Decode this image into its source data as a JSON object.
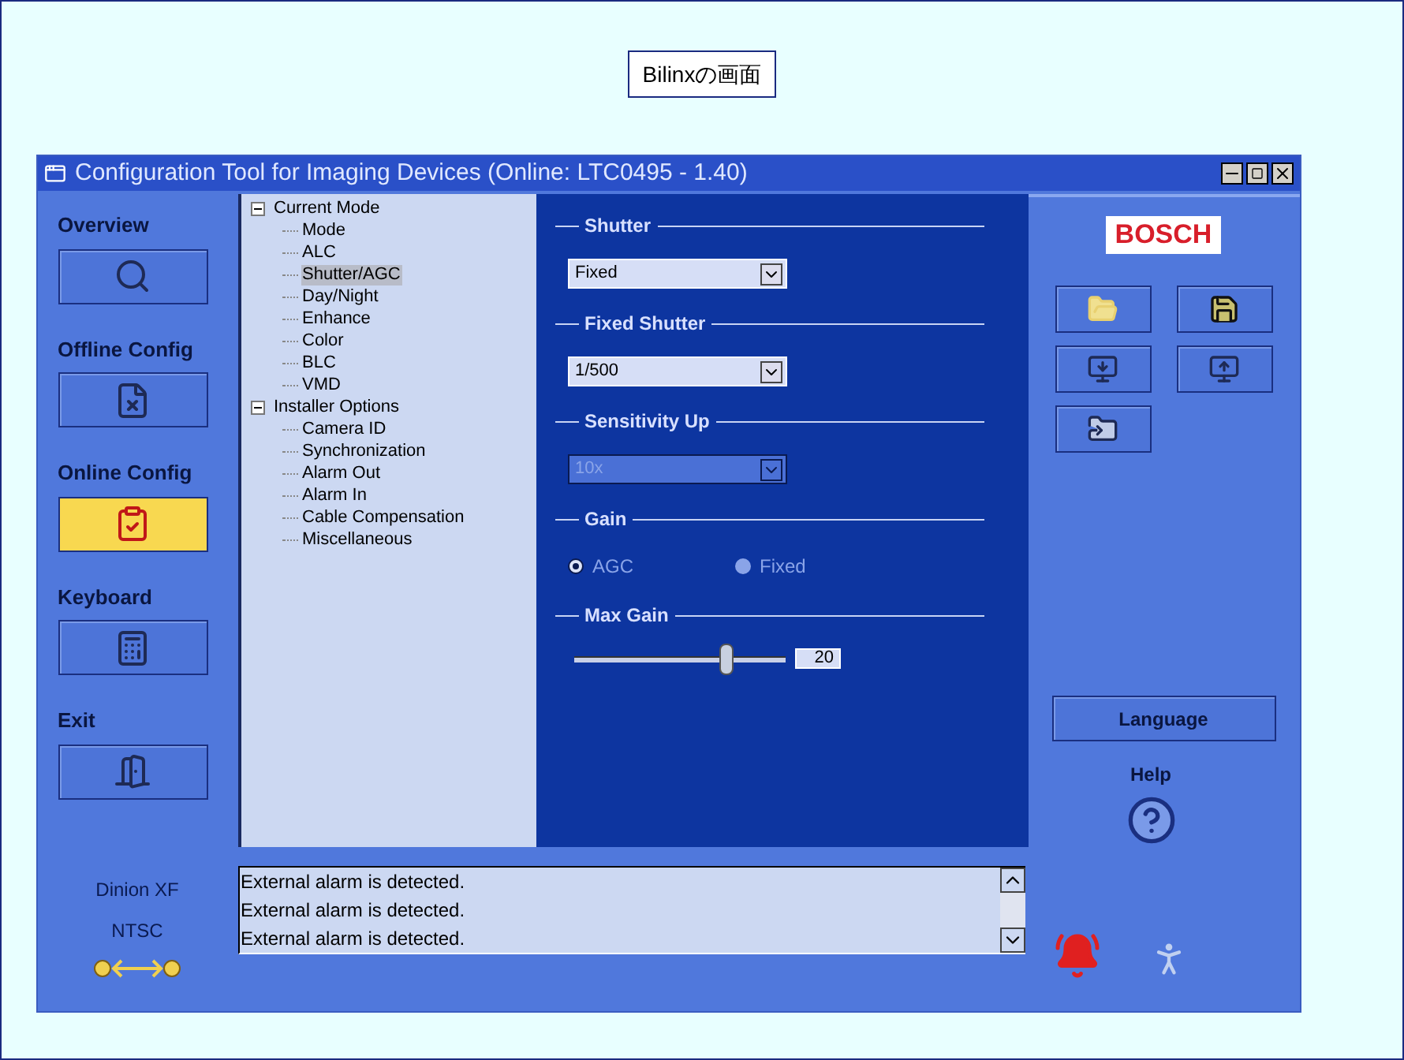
{
  "caption": "Bilinxの画面",
  "window": {
    "title": "Configuration Tool for Imaging Devices (Online: LTC0495 - 1.40)"
  },
  "nav": [
    {
      "label": "Overview",
      "kind": "overview",
      "selected": false
    },
    {
      "label": "Offline Config",
      "kind": "offline",
      "selected": false
    },
    {
      "label": "Online Config",
      "kind": "online",
      "selected": true
    },
    {
      "label": "Keyboard",
      "kind": "keyboard",
      "selected": false
    },
    {
      "label": "Exit",
      "kind": "exit",
      "selected": false
    }
  ],
  "tree": [
    {
      "label": "Current Mode",
      "expanded": true,
      "selected": false,
      "children": [
        {
          "label": "Mode",
          "selected": false
        },
        {
          "label": "ALC",
          "selected": false
        },
        {
          "label": "Shutter/AGC",
          "selected": true
        },
        {
          "label": "Day/Night",
          "selected": false
        },
        {
          "label": "Enhance",
          "selected": false
        },
        {
          "label": "Color",
          "selected": false
        },
        {
          "label": "BLC",
          "selected": false
        },
        {
          "label": "VMD",
          "selected": false
        }
      ]
    },
    {
      "label": "Installer Options",
      "expanded": true,
      "selected": false,
      "children": [
        {
          "label": "Camera ID",
          "selected": false
        },
        {
          "label": "Synchronization",
          "selected": false
        },
        {
          "label": "Alarm Out",
          "selected": false
        },
        {
          "label": "Alarm In",
          "selected": false
        },
        {
          "label": "Cable Compensation",
          "selected": false
        },
        {
          "label": "Miscellaneous",
          "selected": false
        }
      ]
    }
  ],
  "settings": [
    {
      "title": "Shutter",
      "kind": "dropdown",
      "value": "Fixed",
      "disabled": false
    },
    {
      "title": "Fixed Shutter",
      "kind": "dropdown",
      "value": "1/500",
      "disabled": false
    },
    {
      "title": "Sensitivity Up",
      "kind": "dropdown",
      "value": "10x",
      "disabled": true
    },
    {
      "title": "Gain",
      "kind": "radio",
      "disabled": true,
      "options": [
        {
          "label": "AGC",
          "selected": true
        },
        {
          "label": "Fixed",
          "selected": false
        }
      ]
    },
    {
      "title": "Max Gain",
      "kind": "slider",
      "level": 0.72,
      "reading": "20"
    }
  ],
  "logo": "BOSCH",
  "language_button": "Language",
  "help_label": "Help",
  "device": {
    "model": "Dinion XF",
    "standard": "NTSC"
  },
  "log": [
    "External alarm is detected.",
    "External alarm is detected.",
    "External alarm is detected."
  ]
}
